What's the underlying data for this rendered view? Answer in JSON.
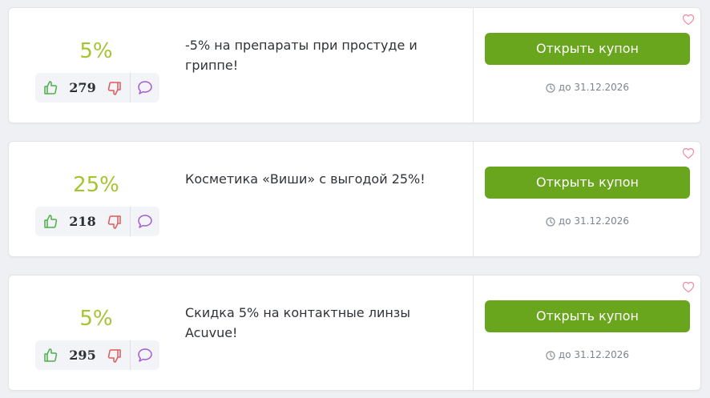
{
  "colors": {
    "percent": "#a4c431",
    "button": "#6aa51e",
    "thumb_up": "#4cae4c",
    "thumb_down": "#e05a5a",
    "comment": "#a15bd3",
    "heart": "#f08aa0"
  },
  "icons": {
    "thumb_up": "thumb-up-icon",
    "thumb_down": "thumb-down-icon",
    "comment": "comment-icon",
    "clock": "clock-icon",
    "heart": "heart-icon"
  },
  "coupons": [
    {
      "percent": "5%",
      "votes": "279",
      "description": "-5% на препараты при простуде и гриппе!",
      "button_label": "Открыть купон",
      "expiry": "до 31.12.2026"
    },
    {
      "percent": "25%",
      "votes": "218",
      "description": "Косметика «Виши» с выгодой 25%!",
      "button_label": "Открыть купон",
      "expiry": "до 31.12.2026"
    },
    {
      "percent": "5%",
      "votes": "295",
      "description": "Скидка 5% на контактные линзы Acuvue!",
      "button_label": "Открыть купон",
      "expiry": "до 31.12.2026"
    }
  ]
}
